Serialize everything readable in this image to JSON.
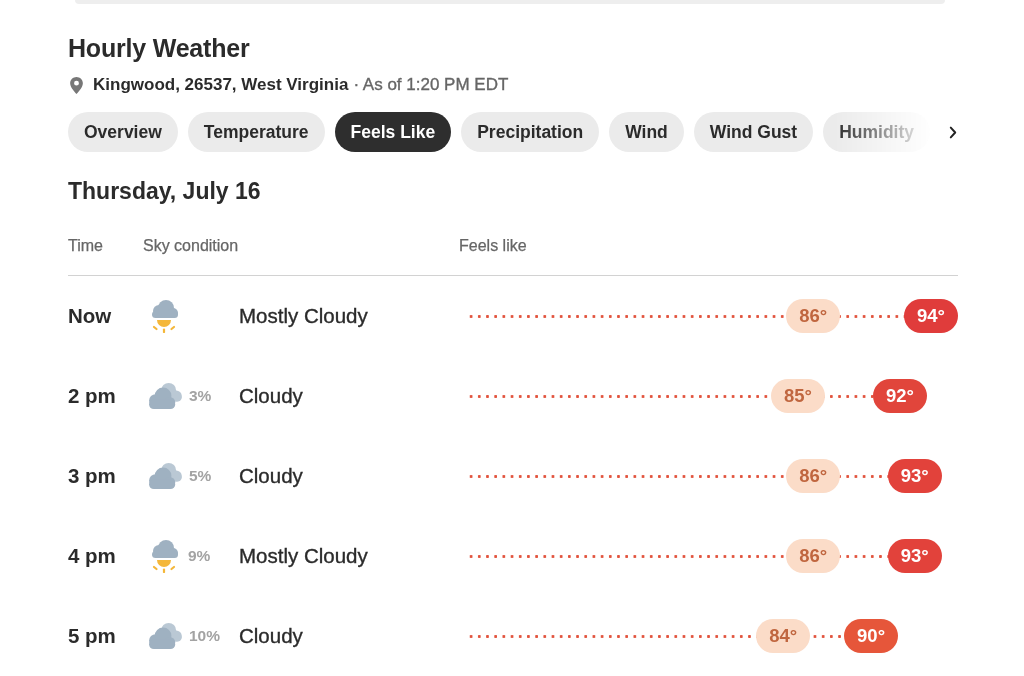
{
  "header": {
    "title": "Hourly Weather",
    "location": "Kingwood, 26537, West Virginia",
    "as_of": "· As of 1:20 PM EDT"
  },
  "tabs": [
    {
      "label": "Overview",
      "selected": false
    },
    {
      "label": "Temperature",
      "selected": false
    },
    {
      "label": "Feels Like",
      "selected": true
    },
    {
      "label": "Precipitation",
      "selected": false
    },
    {
      "label": "Wind",
      "selected": false
    },
    {
      "label": "Wind Gust",
      "selected": false
    },
    {
      "label": "Humidity",
      "selected": false
    }
  ],
  "day": {
    "title": "Thursday, July 16"
  },
  "table": {
    "columns": [
      "Time",
      "Sky condition",
      "Feels like"
    ],
    "rows": [
      {
        "time": "Now",
        "kind": "partial",
        "condition": "Mostly Cloudy",
        "temperature": {
          "text": "86°",
          "level": 0.705
        },
        "feels_like": {
          "text": "94°",
          "level": 0.945,
          "color": "#e03c3b"
        }
      },
      {
        "time": "2 pm",
        "kind": "overcast",
        "precip": "3%",
        "condition": "Cloudy",
        "temperature": {
          "text": "85°",
          "level": 0.674
        },
        "feels_like": {
          "text": "92°",
          "level": 0.882,
          "color": "#e1453b"
        }
      },
      {
        "time": "3 pm",
        "kind": "overcast",
        "precip": "5%",
        "condition": "Cloudy",
        "temperature": {
          "text": "86°",
          "level": 0.705
        },
        "feels_like": {
          "text": "93°",
          "level": 0.912,
          "color": "#e2423b"
        }
      },
      {
        "time": "4 pm",
        "kind": "partial",
        "precip": "9%",
        "condition": "Mostly Cloudy",
        "temperature": {
          "text": "86°",
          "level": 0.705
        },
        "feels_like": {
          "text": "93°",
          "level": 0.912,
          "color": "#e2423b"
        }
      },
      {
        "time": "5 pm",
        "kind": "overcast",
        "precip": "10%",
        "condition": "Cloudy",
        "temperature": {
          "text": "84°",
          "level": 0.644
        },
        "feels_like": {
          "text": "90°",
          "level": 0.823,
          "color": "#e6563a"
        }
      }
    ]
  }
}
